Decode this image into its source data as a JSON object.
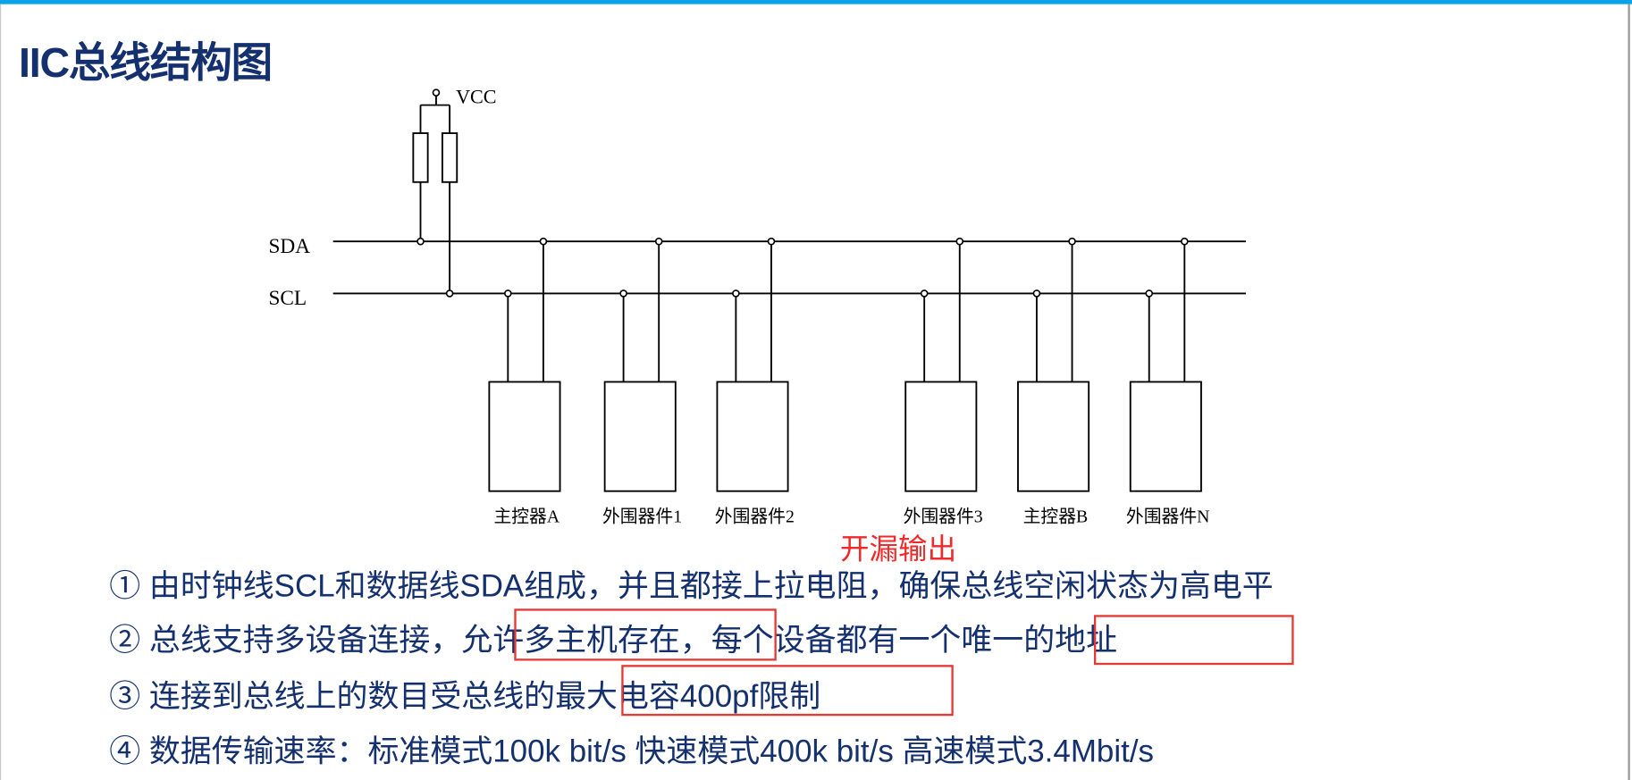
{
  "title": "IIC总线结构图",
  "diagram": {
    "vcc_label": "VCC",
    "sda_label": "SDA",
    "scl_label": "SCL",
    "devices": [
      "主控器A",
      "外围器件1",
      "外围器件2",
      "外围器件3",
      "主控器B",
      "外围器件N"
    ],
    "annotation": "开漏输出"
  },
  "points": [
    "① 由时钟线SCL和数据线SDA组成，并且都接上拉电阻，确保总线空闲状态为高电平",
    "② 总线支持多设备连接，允许多主机存在，每个设备都有一个唯一的地址",
    "③ 连接到总线上的数目受总线的最大电容400pf限制",
    "④ 数据传输速率：标准模式100k bit/s  快速模式400k bit/s 高速模式3.4Mbit/s"
  ],
  "colors": {
    "accent": "#0aa3e6",
    "text": "#14306e",
    "highlight": "#e53935"
  }
}
